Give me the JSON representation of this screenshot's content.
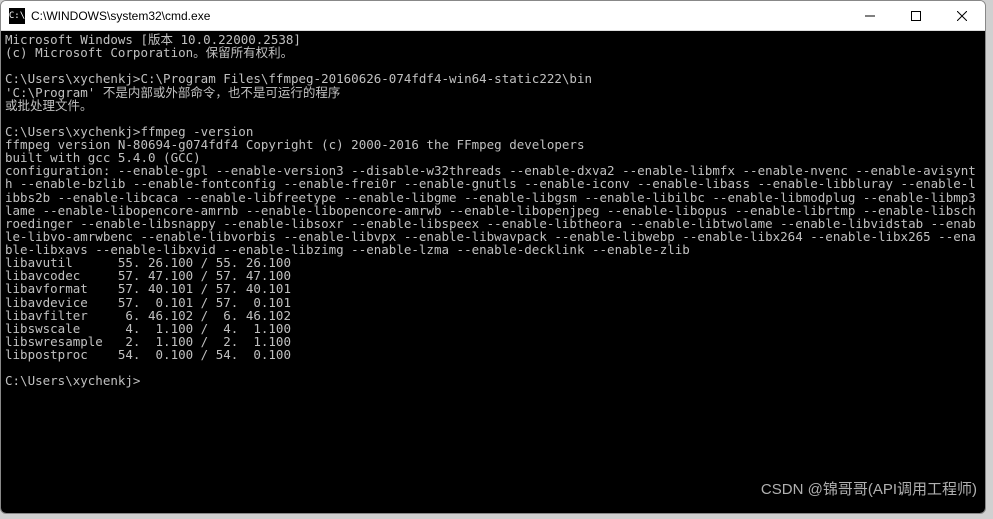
{
  "window": {
    "icon_label": "C:\\",
    "title": "C:\\WINDOWS\\system32\\cmd.exe"
  },
  "terminal": {
    "lines": [
      "Microsoft Windows [版本 10.0.22000.2538]",
      "(c) Microsoft Corporation。保留所有权利。",
      "",
      "C:\\Users\\xychenkj>C:\\Program Files\\ffmpeg-20160626-074fdf4-win64-static222\\bin",
      "'C:\\Program' 不是内部或外部命令，也不是可运行的程序",
      "或批处理文件。",
      "",
      "C:\\Users\\xychenkj>ffmpeg -version",
      "ffmpeg version N-80694-g074fdf4 Copyright (c) 2000-2016 the FFmpeg developers",
      "built with gcc 5.4.0 (GCC)",
      "configuration: --enable-gpl --enable-version3 --disable-w32threads --enable-dxva2 --enable-libmfx --enable-nvenc --enable-avisynth --enable-bzlib --enable-fontconfig --enable-frei0r --enable-gnutls --enable-iconv --enable-libass --enable-libbluray --enable-libbs2b --enable-libcaca --enable-libfreetype --enable-libgme --enable-libgsm --enable-libilbc --enable-libmodplug --enable-libmp3lame --enable-libopencore-amrnb --enable-libopencore-amrwb --enable-libopenjpeg --enable-libopus --enable-librtmp --enable-libschroedinger --enable-libsnappy --enable-libsoxr --enable-libspeex --enable-libtheora --enable-libtwolame --enable-libvidstab --enable-libvo-amrwbenc --enable-libvorbis --enable-libvpx --enable-libwavpack --enable-libwebp --enable-libx264 --enable-libx265 --enable-libxavs --enable-libxvid --enable-libzimg --enable-lzma --enable-decklink --enable-zlib",
      "libavutil      55. 26.100 / 55. 26.100",
      "libavcodec     57. 47.100 / 57. 47.100",
      "libavformat    57. 40.101 / 57. 40.101",
      "libavdevice    57.  0.101 / 57.  0.101",
      "libavfilter     6. 46.102 /  6. 46.102",
      "libswscale      4.  1.100 /  4.  1.100",
      "libswresample   2.  1.100 /  2.  1.100",
      "libpostproc    54.  0.100 / 54.  0.100",
      "",
      "C:\\Users\\xychenkj>"
    ]
  },
  "watermark": "CSDN @锦哥哥(API调用工程师)"
}
